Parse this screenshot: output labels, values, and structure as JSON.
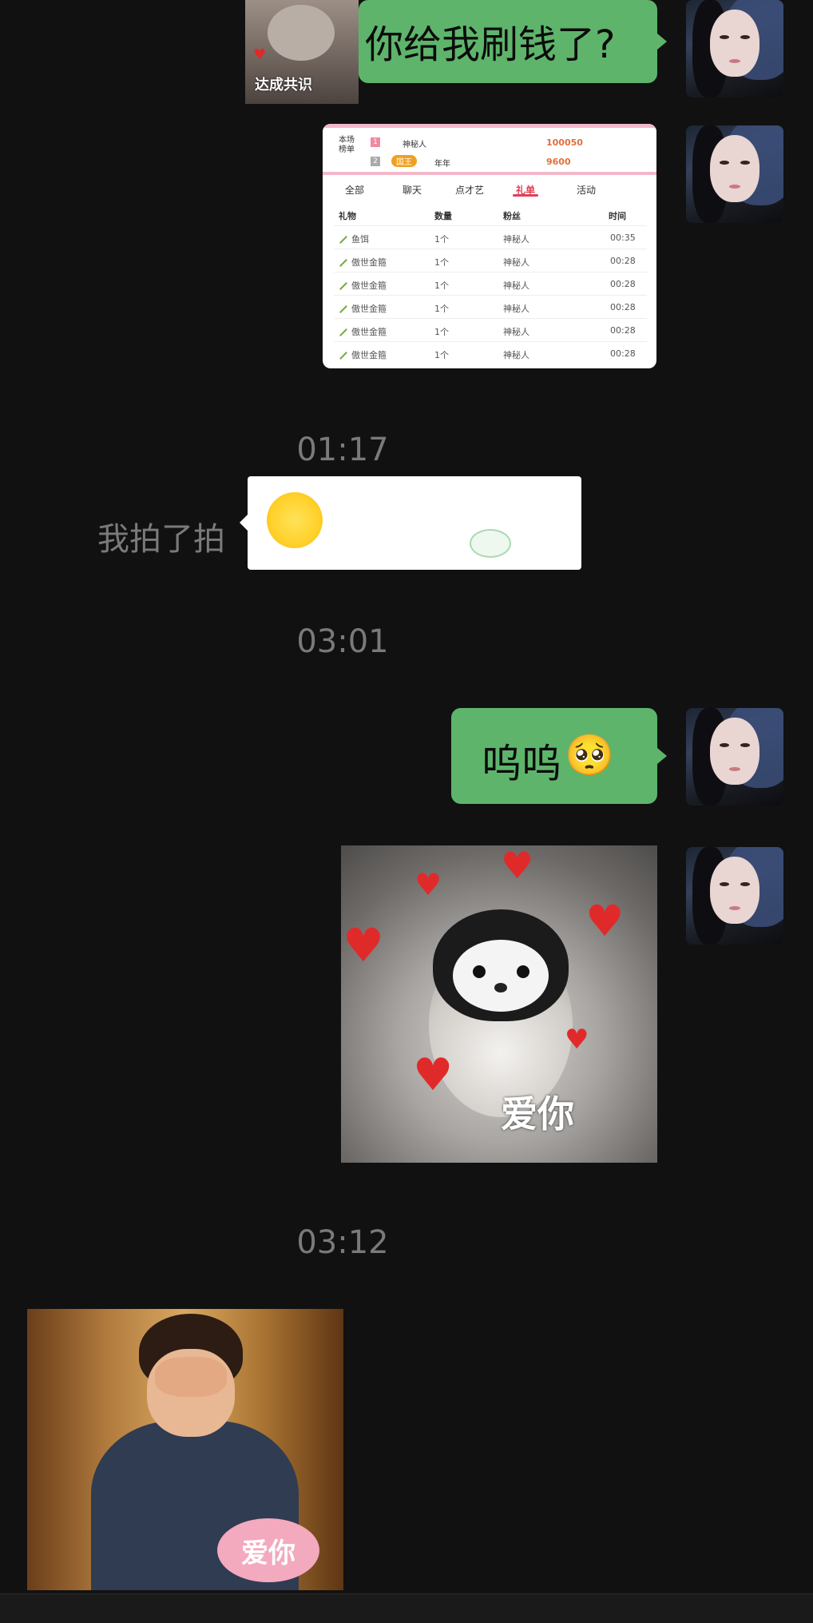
{
  "messages": {
    "m1": {
      "text": "你给我刷钱了?",
      "sticker_caption": "达成共识"
    },
    "gift_screenshot": {
      "rank_label": "本场榜单",
      "ranks": [
        {
          "no": "1",
          "name": "神秘人",
          "value": "100050"
        },
        {
          "no": "2",
          "badge": "国王",
          "name": "年年",
          "value": "9600"
        }
      ],
      "tabs": [
        "全部",
        "聊天",
        "点才艺",
        "礼单",
        "活动"
      ],
      "active_tab": "礼单",
      "headers": [
        "礼物",
        "数量",
        "粉丝",
        "时间"
      ],
      "rows": [
        {
          "gift": "鱼饵",
          "qty": "1个",
          "fan": "神秘人",
          "time": "00:35"
        },
        {
          "gift": "傲世金箍",
          "qty": "1个",
          "fan": "神秘人",
          "time": "00:28"
        },
        {
          "gift": "傲世金箍",
          "qty": "1个",
          "fan": "神秘人",
          "time": "00:28"
        },
        {
          "gift": "傲世金箍",
          "qty": "1个",
          "fan": "神秘人",
          "time": "00:28"
        },
        {
          "gift": "傲世金箍",
          "qty": "1个",
          "fan": "神秘人",
          "time": "00:28"
        },
        {
          "gift": "傲世金箍",
          "qty": "1个",
          "fan": "神秘人",
          "time": "00:28"
        }
      ]
    },
    "ts1": "01:17",
    "pat_text": "我拍了拍",
    "ts2": "03:01",
    "m2": {
      "text": "呜呜",
      "emoji": "🥺"
    },
    "penguin_caption": "爱你",
    "ts3": "03:12",
    "kid_caption": "爱你"
  },
  "colors": {
    "background": "#111111",
    "my_bubble": "#5eb46b",
    "timestamp": "#7a7a7a"
  }
}
